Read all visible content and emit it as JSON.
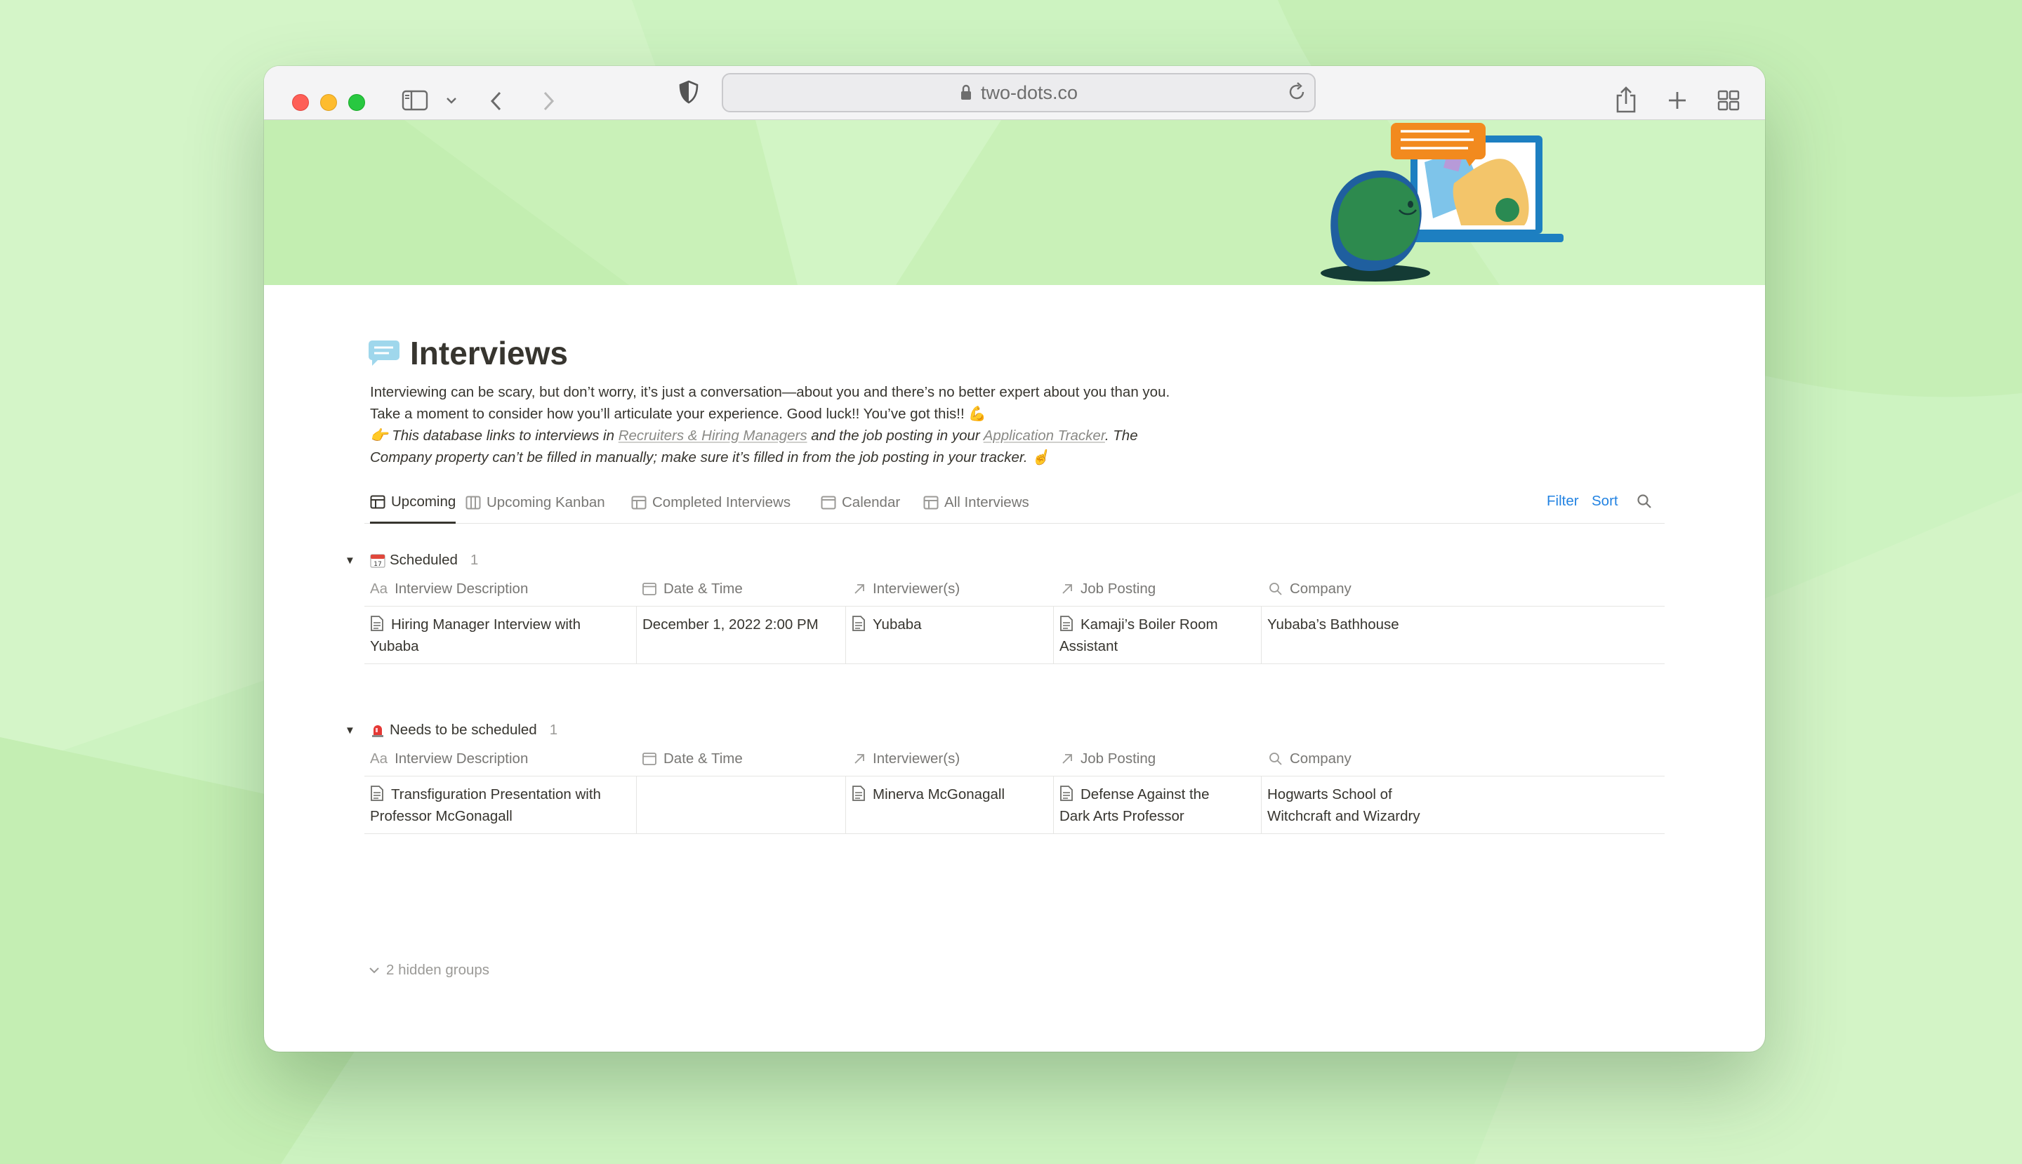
{
  "browser": {
    "url": "two-dots.co"
  },
  "page": {
    "title": "Interviews",
    "description": "Interviewing can be scary, but don’t worry, it’s just a conversation—about you and there’s no better expert about you than you. Take a moment to consider how you’ll articulate your experience. Good luck!! You’ve got this!! 💪",
    "note": {
      "emoji": "👉",
      "text_1": "This database links to interviews in",
      "link_1": "Recruiters & Hiring Managers",
      "text_2": "and the job posting in your",
      "link_2": "Application Tracker",
      "text_3": ". The Company property can’t be filled in manually; make sure it’s filled in from the job posting in your tracker. ☝️"
    }
  },
  "tabs": [
    {
      "label": "Upcoming",
      "icon": "table-icon",
      "active": true
    },
    {
      "label": "Upcoming Kanban",
      "icon": "board-icon",
      "active": false
    },
    {
      "label": "Completed Interviews",
      "icon": "table-icon",
      "active": false
    },
    {
      "label": "Calendar",
      "icon": "calendar-icon",
      "active": false
    },
    {
      "label": "All Interviews",
      "icon": "table-icon",
      "active": false
    }
  ],
  "tools": {
    "filter": "Filter",
    "sort": "Sort",
    "search_icon": "search-icon"
  },
  "columns": [
    "Interview Description",
    "Date & Time",
    "Interviewer(s)",
    "Job Posting",
    "Company"
  ],
  "column_icons": [
    "text-aa-icon",
    "calendar-icon",
    "relation-arrow-icon",
    "relation-arrow-icon",
    "search-icon"
  ],
  "header_prefix": "Aa",
  "groups": [
    {
      "name": "Scheduled",
      "emoji": "📅",
      "count": "1",
      "rows": [
        {
          "description_1": "Hiring Manager Interview with",
          "description_2": "Yubaba",
          "datetime": "December 1, 2022 2:00 PM",
          "interviewer": "Yubaba",
          "job_1": "Kamaji’s Boiler Room",
          "job_2": "Assistant",
          "company_1": "Yubaba’s Bathhouse",
          "company_2": ""
        }
      ]
    },
    {
      "name": "Needs to be scheduled",
      "emoji": "🚨",
      "count": "1",
      "rows": [
        {
          "description_1": "Transfiguration Presentation with",
          "description_2": "Professor McGonagall",
          "datetime": "",
          "interviewer": "Minerva McGonagall",
          "job_1": "Defense Against the",
          "job_2": "Dark Arts Professor",
          "company_1": "Hogwarts School of",
          "company_2": "Witchcraft and Wizardry"
        }
      ]
    }
  ],
  "hidden_groups": "2 hidden groups",
  "colors": {
    "background": "#cdf3c1",
    "cover": "#c9f1b8",
    "text": "#37352f",
    "muted": "#787774",
    "accent_blue": "#2383e2"
  }
}
